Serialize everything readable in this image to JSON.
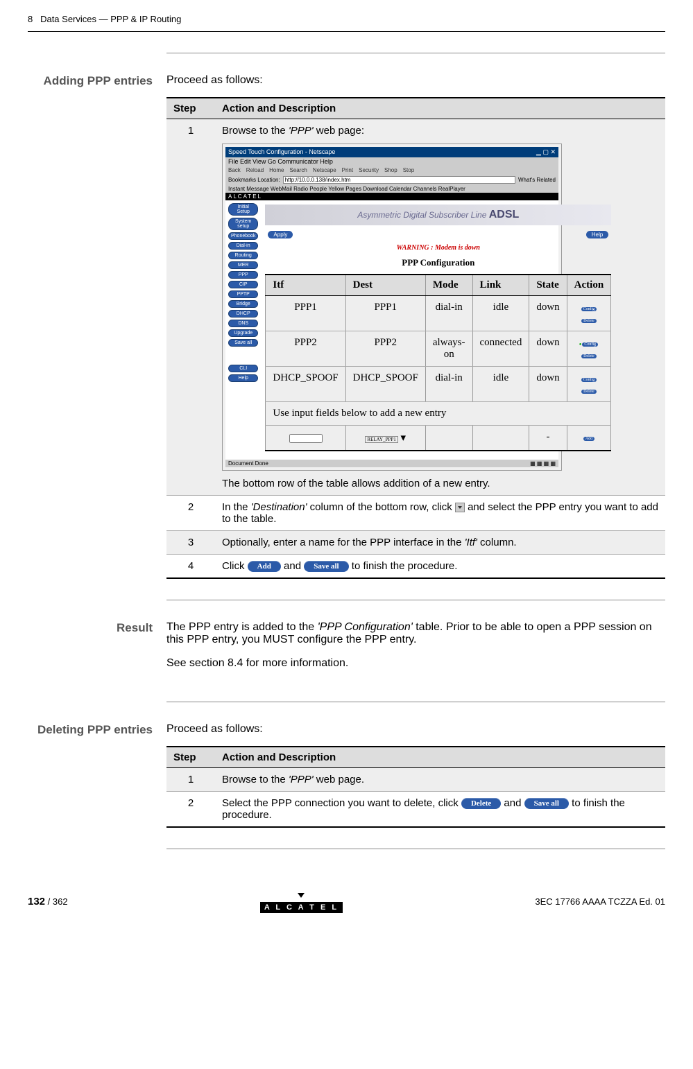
{
  "header": {
    "chapter_num": "8",
    "chapter_title": "Data Services — PPP & IP Routing"
  },
  "adding": {
    "label": "Adding PPP entries",
    "intro": "Proceed as follows:",
    "col_step": "Step",
    "col_action": "Action and Description",
    "step1_num": "1",
    "step1_a": "Browse to the ",
    "step1_ppp": "'PPP'",
    "step1_b": " web page:",
    "step1_bottom": "The bottom row of the table allows addition of a new entry.",
    "step2_num": "2",
    "step2_a": "In the ",
    "step2_dest": "'Destination'",
    "step2_b": " column of the bottom row, click ",
    "step2_c": " and select the PPP entry you want to add to the table.",
    "step3_num": "3",
    "step3_a": "Optionally, enter a name for the PPP interface in the ",
    "step3_itf": "'Itf'",
    "step3_b": " column.",
    "step4_num": "4",
    "step4_a": "Click ",
    "step4_add": "Add",
    "step4_b": " and ",
    "step4_save": "Save all",
    "step4_c": " to finish the procedure."
  },
  "screenshot": {
    "window_title": "Speed Touch Configuration - Netscape",
    "menu": "File  Edit  View  Go  Communicator  Help",
    "tb_back": "Back",
    "tb_reload": "Reload",
    "tb_home": "Home",
    "tb_search": "Search",
    "tb_netscape": "Netscape",
    "tb_print": "Print",
    "tb_security": "Security",
    "tb_shop": "Shop",
    "tb_stop": "Stop",
    "bookmarks": "Bookmarks",
    "location_label": "Location:",
    "location_url": "http://10.0.0.138/index.htm",
    "whats_related": "What's Related",
    "links": "Instant Message   WebMail   Radio   People   Yellow Pages   Download   Calendar   Channels   RealPlayer",
    "brand": "ALCATEL",
    "nav_initial": "Initial Setup",
    "nav_system": "System setup",
    "nav_phonebook": "Phonebook",
    "nav_dialin": "Dial-in",
    "nav_routing": "Routing",
    "nav_mer": "MER",
    "nav_ppp": "PPP",
    "nav_cip": "CIP",
    "nav_pptp": "PPTP",
    "nav_bridge": "Bridge",
    "nav_dhcp": "DHCP",
    "nav_dns": "DNS",
    "nav_upgrade": "Upgrade",
    "nav_saveall": "Save all",
    "nav_cli": "CLI",
    "nav_help": "Help",
    "banner_text": "Asymmetric Digital Subscriber Line",
    "banner_adsl": "ADSL",
    "apply": "Apply",
    "help": "Help",
    "warning": "WARNING : Modem is down",
    "ppp_title": "PPP Configuration",
    "th_itf": "Itf",
    "th_dest": "Dest",
    "th_mode": "Mode",
    "th_link": "Link",
    "th_state": "State",
    "th_action": "Action",
    "r1_itf": "PPP1",
    "r1_dest": "PPP1",
    "r1_mode": "dial-in",
    "r1_link": "idle",
    "r1_state": "down",
    "r2_itf": "PPP2",
    "r2_dest": "PPP2",
    "r2_mode": "always-on",
    "r2_link": "connected",
    "r2_state": "down",
    "r3_itf": "DHCP_SPOOF",
    "r3_dest": "DHCP_SPOOF",
    "r3_mode": "dial-in",
    "r3_link": "idle",
    "r3_state": "down",
    "r4_note": "Use input fields below to add a new entry",
    "r5_relay": "RELAY_PPP1",
    "btn_config": "Config",
    "btn_delete": "Delete",
    "btn_add": "Add",
    "status": "Document Done"
  },
  "result": {
    "label": "Result",
    "p1a": "The PPP entry is added to the ",
    "p1_cfg": "'PPP Configuration'",
    "p1b": " table. Prior to be able to open a PPP session on this PPP entry, you MUST configure the PPP entry.",
    "p2": "See section 8.4 for more information."
  },
  "deleting": {
    "label": "Deleting PPP entries",
    "intro": "Proceed as follows:",
    "col_step": "Step",
    "col_action": "Action and Description",
    "step1_num": "1",
    "step1_a": "Browse to the ",
    "step1_ppp": "'PPP'",
    "step1_b": " web page.",
    "step2_num": "2",
    "step2_a": "Select the PPP connection you want to delete, click ",
    "step2_del": "Delete",
    "step2_b": " and ",
    "step2_save": "Save all",
    "step2_c": " to finish the procedure."
  },
  "footer": {
    "page": "132",
    "total": " / 362",
    "logo": "A L C A T E L",
    "doc_ref": "3EC 17766 AAAA TCZZA Ed. 01"
  }
}
